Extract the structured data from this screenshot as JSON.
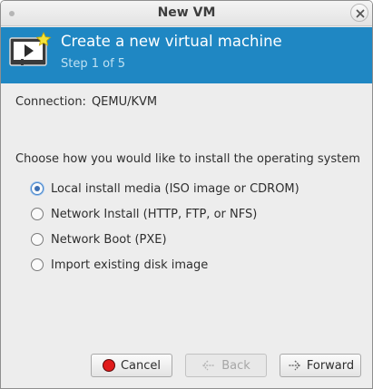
{
  "window": {
    "title": "New VM"
  },
  "banner": {
    "title": "Create a new virtual machine",
    "step": "Step 1 of 5"
  },
  "connection": {
    "label": "Connection:",
    "value": "QEMU/KVM"
  },
  "install": {
    "prompt": "Choose how you would like to install the operating system",
    "options": [
      {
        "label": "Local install media (ISO image or CDROM)",
        "selected": true
      },
      {
        "label": "Network Install (HTTP, FTP, or NFS)",
        "selected": false
      },
      {
        "label": "Network Boot (PXE)",
        "selected": false
      },
      {
        "label": "Import existing disk image",
        "selected": false
      }
    ]
  },
  "buttons": {
    "cancel": "Cancel",
    "back": "Back",
    "forward": "Forward"
  },
  "colors": {
    "banner": "#1f87c3",
    "step_text": "#bfe1f3",
    "cancel_icon": "#e01b1b"
  }
}
